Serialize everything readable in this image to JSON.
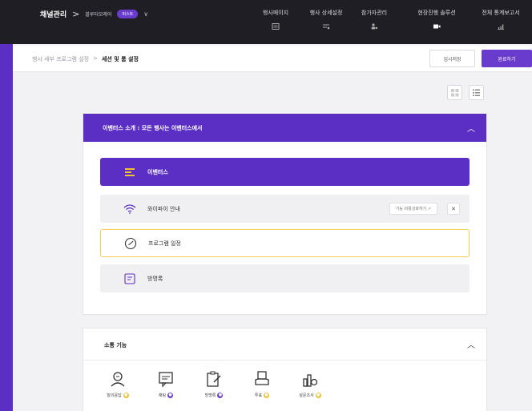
{
  "topbar": {
    "channel_title": "채널관리",
    "separator": ">",
    "project_name": "블루터모레어",
    "badge": "퍼스트",
    "nav": [
      {
        "label": "행사페이지",
        "icon": "page-icon"
      },
      {
        "label": "행사 상세설정",
        "icon": "settings-icon"
      },
      {
        "label": "참가자관리",
        "icon": "people-icon"
      },
      {
        "label": "현장진행 솔루션",
        "icon": "video-icon"
      },
      {
        "label": "전체 통계보고서",
        "icon": "chart-icon"
      }
    ]
  },
  "subheader": {
    "path_parent": "행사 세부 프로그램 설정",
    "path_sep": ">",
    "path_current": "세션 및 룸 설정",
    "temp_save_label": "임시저장",
    "done_label": "완료하기"
  },
  "intro": {
    "title": "이벤터스 소개 : 모든 행사는 이벤터스에서",
    "items": [
      {
        "label": "이벤터스",
        "icon": "menu-icon"
      },
      {
        "label": "와이파이 안내",
        "icon": "wifi-icon",
        "join_label": "기능 비활성화하기 ↗",
        "close_label": "✕"
      },
      {
        "label": "프로그램 일정",
        "icon": "clock-icon"
      },
      {
        "label": "방명록",
        "icon": "guestbook-icon"
      }
    ]
  },
  "comm": {
    "title": "소통 기능",
    "features": [
      {
        "label": "질의응답",
        "dot": "y"
      },
      {
        "label": "채팅",
        "dot": "p"
      },
      {
        "label": "방명록",
        "dot": "p"
      },
      {
        "label": "투표",
        "dot": "y"
      },
      {
        "label": "설문조사",
        "dot": "y"
      }
    ]
  },
  "colors": {
    "accent": "#5b2fc4",
    "dark": "#1e1e24",
    "highlight": "#f1cf4a"
  }
}
